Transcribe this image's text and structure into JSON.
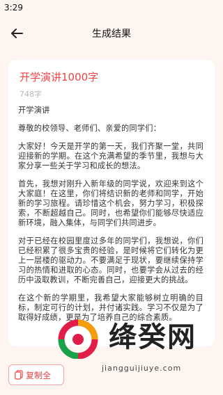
{
  "status": {
    "time": "3:29"
  },
  "nav": {
    "title": "生成结果"
  },
  "card": {
    "title": "开学演讲1000字",
    "word_count": "748字",
    "paragraphs": [
      "开学演讲",
      "尊敬的校领导、老师们、亲爱的同学们：",
      "大家好！今天是开学的第一天，我们齐聚一堂，共同迎接新的学期。在这个充满希望的季节里，我想与大家分享一些关于学习和成长的想法。",
      "首先，我想对刚升入新年级的同学说，欢迎来到这个大家庭！在这里，你们将结识新的老师和同学，开始新的学习旅程。请珍惜这个机会，努力学习，积极探索，不断超越自己。同时，也希望你们能够尽快适应新环境，融入集体，与同学们共同进步。",
      "对于已经在校园里度过多年的同学们，我想说，你们已经积累了很多宝贵的经验，是时候将它们转化为更上一层楼的驱动力。不要满足于现状，要继续保持学习的热情和进取的心态。同时，也要学会从过去的经历中汲取教训，不断完善自己，迎接更大的挑战。",
      "在这个新的学期里，我希望大家能够树立明确的目标，制定可行的计划，并付诸实践。学习不仅是为了取得好成绩，更是为了培养自己的综合素质。"
    ]
  },
  "bottom": {
    "copy_label": "复制全"
  },
  "watermark": {
    "brand": "绛癸网",
    "url": "jiangguijiuye.com"
  },
  "colors": {
    "accent": "#ef4444",
    "background": "#fff5f0"
  }
}
